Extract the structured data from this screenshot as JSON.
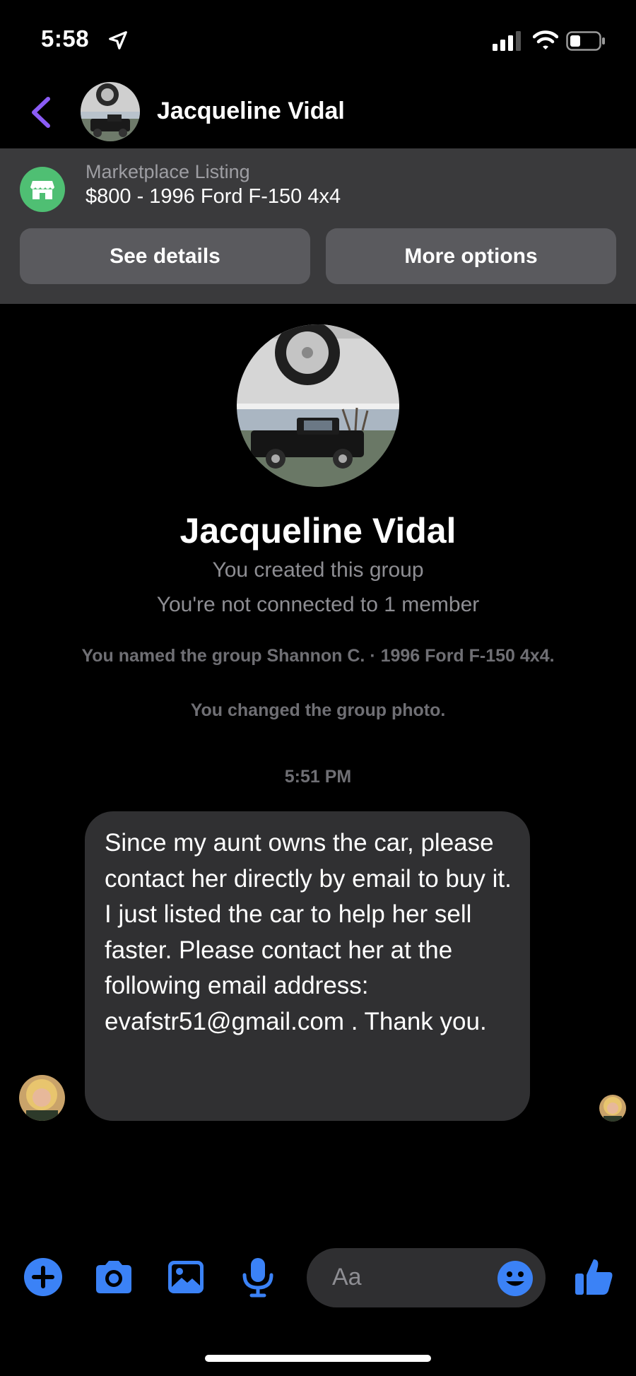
{
  "status_bar": {
    "time": "5:58"
  },
  "header": {
    "contact_name": "Jacqueline Vidal"
  },
  "marketplace": {
    "label": "Marketplace Listing",
    "title": "$800 - 1996 Ford F-150 4x4",
    "see_details_label": "See details",
    "more_options_label": "More options"
  },
  "profile": {
    "name": "Jacqueline Vidal",
    "created_text": "You created this group",
    "connection_text": "You're not connected to 1 member"
  },
  "events": [
    "You named the group Shannon C. · 1996 Ford F-150 4x4.",
    "You changed the group photo."
  ],
  "timestamp": "5:51 PM",
  "message": {
    "text": "Since my aunt owns the car, please contact her directly by email to buy it. I just listed the car to help her sell faster. Please contact her at the following email address: evafstr51@gmail.com . Thank you."
  },
  "composer": {
    "placeholder": "Aa"
  },
  "colors": {
    "accent": "#3b82f6",
    "back_arrow": "#8b5cf6",
    "marketplace_icon": "#4fbf73",
    "panel_bg": "#3a3a3c",
    "bubble_bg": "#303032"
  },
  "icons": [
    "location-arrow-icon",
    "signal-icon",
    "wifi-icon",
    "battery-icon",
    "back-icon",
    "marketplace-store-icon",
    "plus-icon",
    "camera-icon",
    "gallery-icon",
    "microphone-icon",
    "emoji-icon",
    "like-icon"
  ]
}
